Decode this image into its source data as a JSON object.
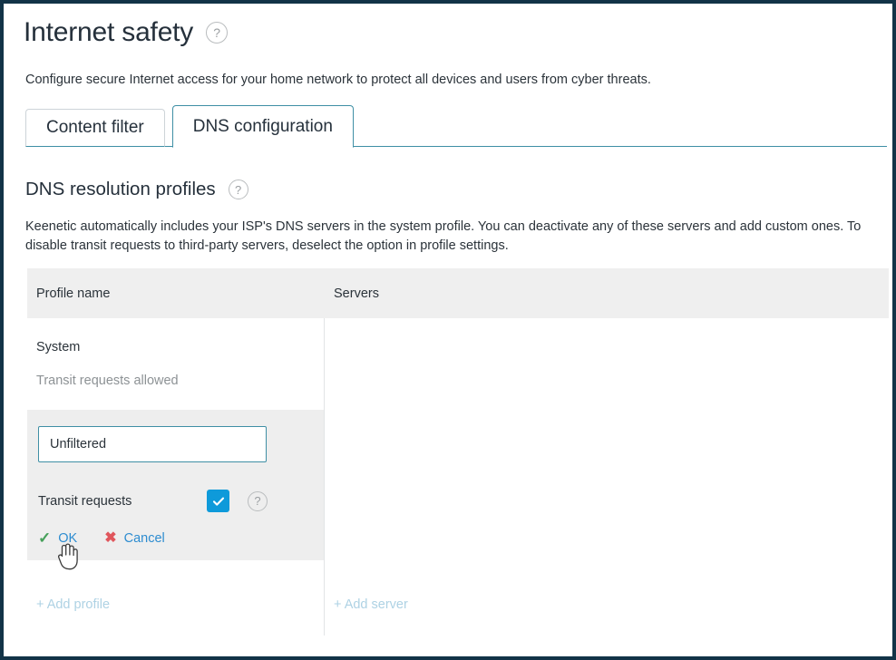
{
  "header": {
    "title": "Internet safety",
    "help_icon": "question-mark-circle-icon",
    "subtitle": "Configure secure Internet access for your home network to protect all devices and users from cyber threats."
  },
  "tabs": [
    {
      "label": "Content filter",
      "active": false
    },
    {
      "label": "DNS configuration",
      "active": true
    }
  ],
  "section": {
    "title": "DNS resolution profiles",
    "help_icon": "question-mark-circle-icon",
    "description": "Keenetic automatically includes your ISP's DNS servers in the system profile. You can deactivate any of these servers and add custom ones. To disable transit requests to third-party servers, deselect the option in profile settings."
  },
  "table": {
    "columns": [
      {
        "key": "profile_name",
        "header": "Profile name"
      },
      {
        "key": "servers",
        "header": "Servers"
      }
    ],
    "rows": [
      {
        "profile_name": "System",
        "profile_status": "Transit requests allowed",
        "servers": ""
      }
    ],
    "add_profile_label": "+ Add profile",
    "add_server_label": "+ Add server"
  },
  "edit_form": {
    "name_value": "Unfiltered",
    "name_placeholder": "Profile name",
    "transit_label": "Transit requests",
    "transit_checked": true,
    "transit_help_icon": "question-mark-circle-icon",
    "ok_label": "OK",
    "ok_icon": "check-icon",
    "cancel_label": "Cancel",
    "cancel_icon": "cross-icon"
  },
  "cursor": {
    "icon": "pointing-hand-cursor"
  },
  "colors": {
    "accent": "#3f8fa5",
    "checkbox": "#0e9ada",
    "link": "#2d8cd0",
    "ok_green": "#46a05a",
    "cancel_red": "#e0565c",
    "muted_link": "#aed2e4",
    "text": "#2b333a",
    "muted_text": "#8d9295",
    "header_bg": "#efefef",
    "edit_bg": "#eeeeee",
    "frame": "#123347"
  }
}
